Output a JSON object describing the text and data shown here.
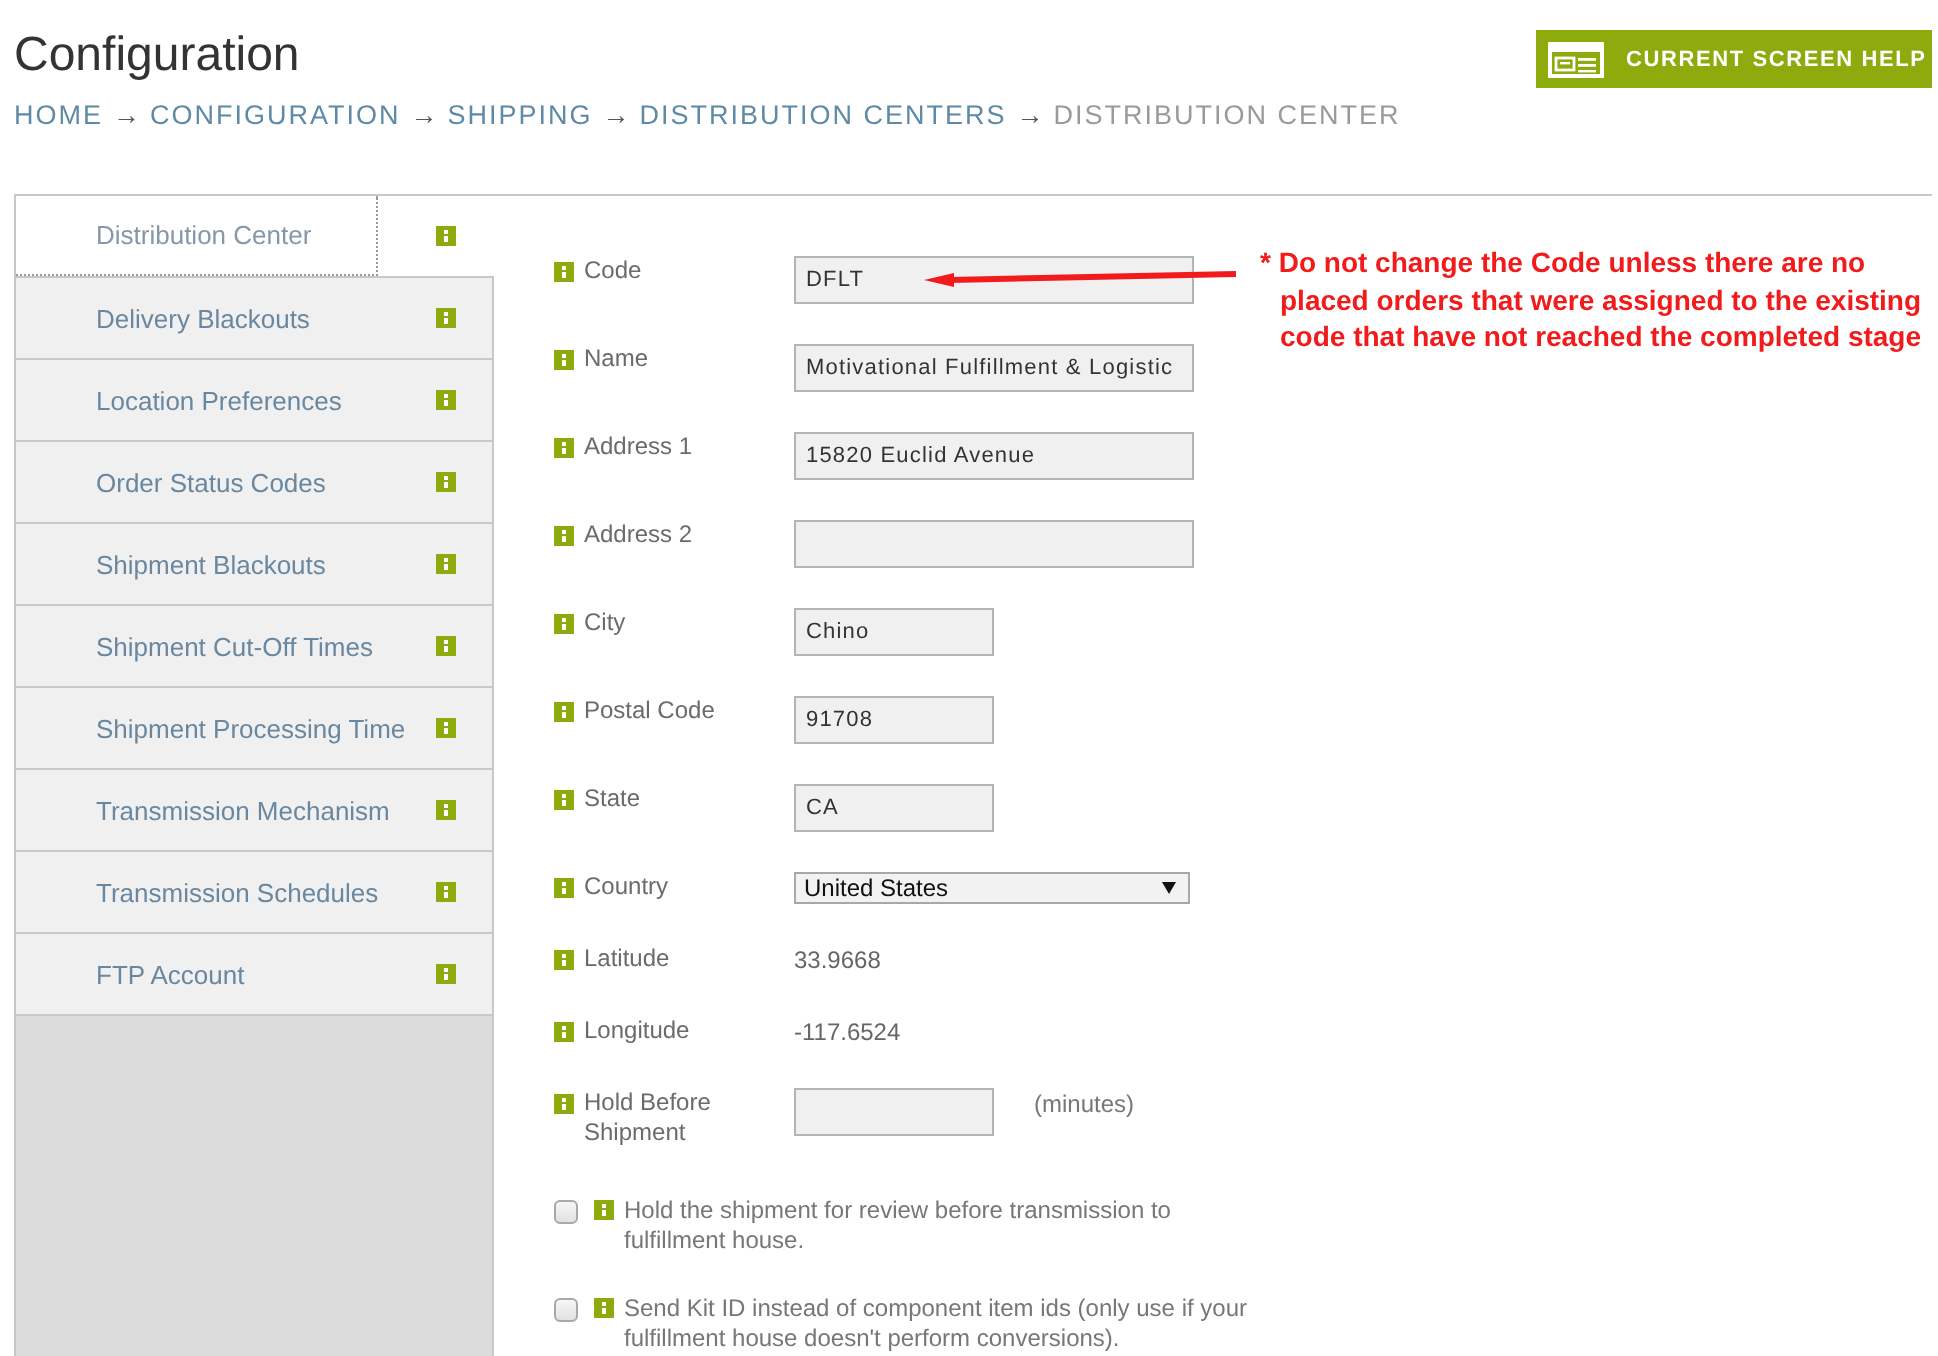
{
  "header": {
    "title": "Configuration",
    "help_button": "CURRENT SCREEN HELP"
  },
  "breadcrumb": [
    {
      "label": "HOME",
      "separator": "→",
      "current": false
    },
    {
      "label": "CONFIGURATION",
      "separator": "→",
      "current": false
    },
    {
      "label": "SHIPPING",
      "separator": "→",
      "current": false
    },
    {
      "label": "DISTRIBUTION CENTERS",
      "separator": "→",
      "current": false
    },
    {
      "label": "DISTRIBUTION CENTER",
      "current": true
    }
  ],
  "sidebar": {
    "tabs": [
      {
        "label": "Distribution Center",
        "selected": true
      },
      {
        "label": "Delivery Blackouts",
        "selected": false
      },
      {
        "label": "Location Preferences",
        "selected": false
      },
      {
        "label": "Order Status Codes",
        "selected": false
      },
      {
        "label": "Shipment Blackouts",
        "selected": false
      },
      {
        "label": "Shipment Cut-Off Times",
        "selected": false
      },
      {
        "label": "Shipment Processing Time",
        "selected": false
      },
      {
        "label": "Transmission Mechanism",
        "selected": false
      },
      {
        "label": "Transmission Schedules",
        "selected": false
      },
      {
        "label": "FTP Account",
        "selected": false
      }
    ]
  },
  "form": {
    "fields": [
      {
        "kind": "field",
        "label": "Code",
        "value": "DFLT"
      },
      {
        "kind": "field",
        "label": "Name",
        "value": "Motivational Fulfillment & Logistic"
      },
      {
        "kind": "field",
        "label": "Address 1",
        "value": "15820 Euclid Avenue"
      },
      {
        "kind": "field",
        "label": "Address 2"
      },
      {
        "kind": "shortfield",
        "label": "City",
        "value": "Chino"
      },
      {
        "kind": "shortfield",
        "label": "Postal Code",
        "value": "91708"
      },
      {
        "kind": "shortfield",
        "label": "State",
        "value": "CA"
      },
      {
        "kind": "select",
        "label": "Country",
        "value": "United States"
      },
      {
        "kind": "readout",
        "label": "Latitude",
        "value": "33.9668"
      },
      {
        "kind": "readout",
        "label": "Longitude",
        "value": "-117.6524"
      },
      {
        "kind": "shortfield",
        "label": "Hold Before Shipment",
        "unit": "(minutes)"
      }
    ],
    "options": [
      {
        "label": "Hold the shipment for review before transmission to fulfillment house.",
        "checked": false
      },
      {
        "label": "Send Kit ID instead of component item ids (only use if your fulfillment house doesn't perform conversions).",
        "checked": false
      }
    ]
  },
  "annotation": {
    "lines": [
      "* Do not change the Code unless there are no",
      "placed orders that were assigned to the existing",
      "code that have not reached the completed stage"
    ]
  }
}
